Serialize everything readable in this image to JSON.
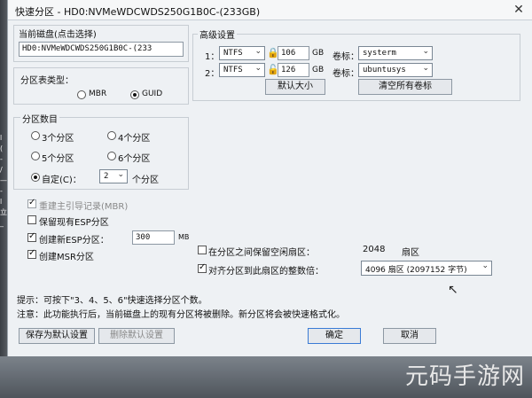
{
  "window": {
    "title": "快速分区 - HD0:NVMeWDCWDS250G1B0C-(233GB)",
    "close_glyph": "✕"
  },
  "disk_panel": {
    "label": "当前磁盘(点击选择)",
    "value": "HD0:NVMeWDCWDS250G1B0C-(233"
  },
  "partition_table": {
    "label": "分区表类型：",
    "mbr": "MBR",
    "guid": "GUID"
  },
  "partition_count": {
    "label": "分区数目",
    "options": [
      "3个分区",
      "4个分区",
      "5个分区",
      "6个分区"
    ],
    "custom_label": "自定(C)：",
    "custom_value": "2",
    "custom_suffix": "个分区"
  },
  "options": {
    "rebuild_mbr": "重建主引导记录(MBR)",
    "keep_esp": "保留现有ESP分区",
    "create_esp": "创建新ESP分区：",
    "esp_size": "300",
    "esp_unit": "MB",
    "create_msr": "创建MSR分区"
  },
  "advanced": {
    "label": "高级设置",
    "rows": [
      {
        "index": "1：",
        "fs": "NTFS",
        "size": "106",
        "unit": "GB",
        "vol_label": "卷标：",
        "vol_value": "systerm"
      },
      {
        "index": "2：",
        "fs": "NTFS",
        "size": "126",
        "unit": "GB",
        "vol_label": "卷标：",
        "vol_value": "ubuntusys"
      }
    ],
    "default_size_btn": "默认大小",
    "clear_labels_btn": "清空所有卷标"
  },
  "sector": {
    "reserve_label": "在分区之间保留空闲扇区：",
    "reserve_value": "2048",
    "reserve_unit": "扇区",
    "align_label": "对齐分区到此扇区的整数倍：",
    "align_value": "4096 扇区 (2097152 字节)"
  },
  "hints": {
    "tip": "提示：可按下\"3、4、5、6\"快速选择分区个数。",
    "note": "注意：此功能执行后，当前磁盘上的现有分区将被删除。新分区将会被快速格式化。"
  },
  "buttons": {
    "save_default": "保存为默认设置",
    "delete_default": "删除默认设置",
    "ok": "确定",
    "cancel": "取消"
  },
  "watermark": "元码手游网",
  "left_fragments": [
    "l",
    "(",
    "-",
    "/",
    "—",
    "-",
    "l",
    "立",
    "_"
  ]
}
